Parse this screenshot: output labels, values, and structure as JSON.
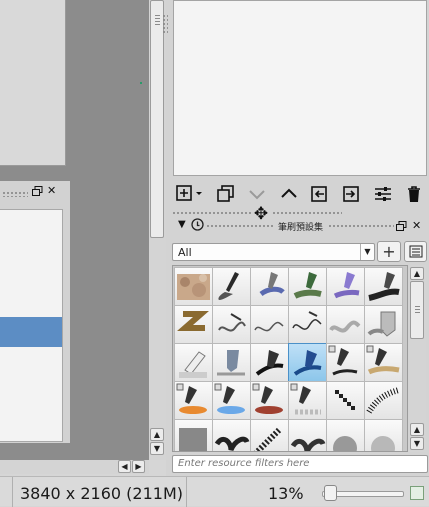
{
  "statusbar": {
    "image_size": "3840 x 2160 (211M)",
    "zoom": "13%",
    "zoom_slider_fraction": 0.05
  },
  "brush_presets": {
    "title": "筆刷預設集",
    "filter_tag": "All",
    "add_tag_button": "+",
    "filter_placeholder": "Enter resource filters here"
  },
  "layers_toolbar": {
    "icons": [
      "add-layer-icon",
      "duplicate-layer-icon",
      "move-down-icon",
      "move-up-icon",
      "properties-in-icon",
      "properties-out-icon",
      "layer-settings-icon",
      "trash-icon"
    ]
  },
  "colors": {
    "canvas_bg": "#8c8c8c",
    "selection": "#5c8dc4",
    "active_preset": "#8cc6ea"
  }
}
